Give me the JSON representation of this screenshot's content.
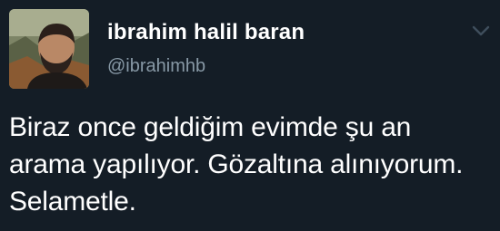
{
  "tweet": {
    "author": {
      "display_name": "ibrahim halil baran",
      "handle": "@ibrahimhb",
      "avatar_icon": "profile-photo"
    },
    "menu_icon": "chevron-down-icon",
    "text": "Biraz once geldiğim evimde şu an\narama yapılıyor. Gözaltına alınıyorum.\nSelametle."
  },
  "colors": {
    "background": "#141d26",
    "name": "#ffffff",
    "handle": "#8899a6",
    "text": "#ffffff"
  }
}
